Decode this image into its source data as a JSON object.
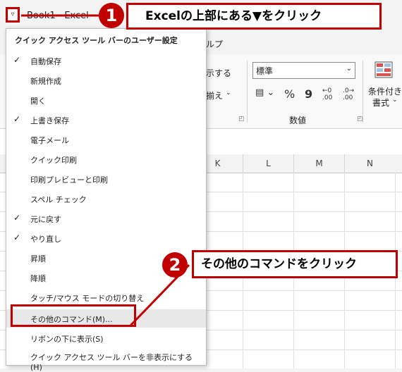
{
  "titlebar": {
    "qat_dropdown_glyph": "▿",
    "book": "Book1",
    "sep": "-",
    "app": "Excel"
  },
  "ribbon": {
    "help_tab": "ルプ",
    "wrap_text": "示する",
    "merge": "揃え",
    "number_format": "標準",
    "number_group_label": "数値",
    "conditional_line1": "条件付き",
    "conditional_line2": "書式",
    "percent": "%",
    "comma": "9",
    "inc_decimal": ".00",
    "dec_decimal": ".00"
  },
  "grid": {
    "columns": [
      "K",
      "L",
      "M",
      "N"
    ]
  },
  "menu": {
    "header": "クイック アクセス ツール バーのユーザー設定",
    "items": [
      {
        "label": "自動保存",
        "checked": "✓"
      },
      {
        "label": "新規作成",
        "checked": ""
      },
      {
        "label": "開く",
        "checked": ""
      },
      {
        "label": "上書き保存",
        "checked": "✓"
      },
      {
        "label": "電子メール",
        "checked": ""
      },
      {
        "label": "クイック印刷",
        "checked": ""
      },
      {
        "label": "印刷プレビューと印刷",
        "checked": ""
      },
      {
        "label": "スペル チェック",
        "checked": ""
      },
      {
        "label": "元に戻す",
        "checked": "✓"
      },
      {
        "label": "やり直し",
        "checked": "✓"
      },
      {
        "label": "昇順",
        "checked": ""
      },
      {
        "label": "降順",
        "checked": ""
      },
      {
        "label": "タッチ/マウス モードの切り替え",
        "checked": ""
      },
      {
        "label": "その他のコマンド(M)...",
        "checked": ""
      },
      {
        "label": "リボンの下に表示(S)",
        "checked": ""
      },
      {
        "label": "クイック アクセス ツール バーを非表示にする (H)",
        "checked": ""
      }
    ]
  },
  "annotations": {
    "step1_number": "1",
    "step1_text": "Excelの上部にある▼をクリック",
    "step2_number": "2",
    "step2_text": "その他のコマンドをクリック",
    "accent_color": "#c00000"
  }
}
